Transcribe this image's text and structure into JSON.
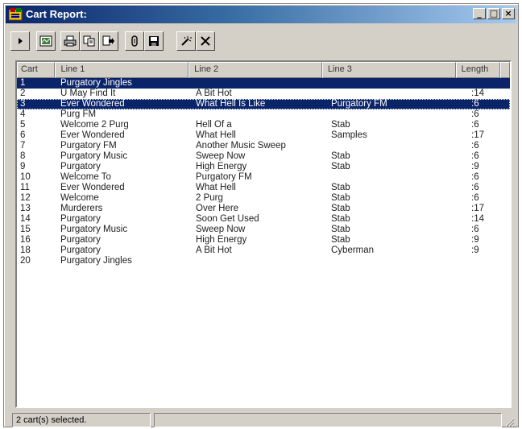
{
  "window": {
    "title": "Cart Report:"
  },
  "toolbar": {
    "buttons": [
      "play-icon",
      "chart-icon",
      "print-icon",
      "copy-icon",
      "export-icon",
      "attach-icon",
      "save-icon",
      "magic-wand-icon",
      "close-x-icon"
    ]
  },
  "table": {
    "columns": [
      "Cart",
      "Line 1",
      "Line 2",
      "Line 3",
      "Length"
    ],
    "rows": [
      {
        "cart": "1",
        "line1": "Purgatory Jingles",
        "line2": "",
        "line3": "",
        "length": ""
      },
      {
        "cart": "2",
        "line1": "U May Find It",
        "line2": "A Bit Hot",
        "line3": "",
        "length": ":14"
      },
      {
        "cart": "3",
        "line1": "Ever Wondered",
        "line2": "What Hell Is Like",
        "line3": "Purgatory FM",
        "length": ":6"
      },
      {
        "cart": "4",
        "line1": "Purg FM",
        "line2": "",
        "line3": "",
        "length": ":6"
      },
      {
        "cart": "5",
        "line1": "Welcome 2 Purg",
        "line2": "Hell Of a",
        "line3": "Stab",
        "length": ":6"
      },
      {
        "cart": "6",
        "line1": "Ever Wondered",
        "line2": "What Hell",
        "line3": "Samples",
        "length": ":17"
      },
      {
        "cart": "7",
        "line1": "Purgatory FM",
        "line2": "Another Music Sweep",
        "line3": "",
        "length": ":6"
      },
      {
        "cart": "8",
        "line1": "Purgatory Music",
        "line2": "Sweep Now",
        "line3": "Stab",
        "length": ":6"
      },
      {
        "cart": "9",
        "line1": "Purgatory",
        "line2": "High Energy",
        "line3": "Stab",
        "length": ":9"
      },
      {
        "cart": "10",
        "line1": "Welcome To",
        "line2": "Purgatory FM",
        "line3": "",
        "length": ":6"
      },
      {
        "cart": "11",
        "line1": "Ever Wondered",
        "line2": "What Hell",
        "line3": "Stab",
        "length": ":6"
      },
      {
        "cart": "12",
        "line1": "Welcome",
        "line2": "2 Purg",
        "line3": "Stab",
        "length": ":6"
      },
      {
        "cart": "13",
        "line1": "Murderers",
        "line2": "Over Here",
        "line3": "Stab",
        "length": ":17"
      },
      {
        "cart": "14",
        "line1": "Purgatory",
        "line2": "Soon Get Used",
        "line3": "Stab",
        "length": ":14"
      },
      {
        "cart": "15",
        "line1": "Purgatory Music",
        "line2": "Sweep Now",
        "line3": "Stab",
        "length": ":6"
      },
      {
        "cart": "16",
        "line1": "Purgatory",
        "line2": "High Energy",
        "line3": "Stab",
        "length": ":9"
      },
      {
        "cart": "18",
        "line1": "Purgatory",
        "line2": "A Bit Hot",
        "line3": "Cyberman",
        "length": ":9"
      },
      {
        "cart": "20",
        "line1": "Purgatory Jingles",
        "line2": "",
        "line3": "",
        "length": ""
      }
    ],
    "selected_rows": [
      0,
      2
    ]
  },
  "statusbar": {
    "text": "2 cart(s) selected."
  },
  "colors": {
    "selection": "#0a246a",
    "face": "#d4d0c8"
  }
}
